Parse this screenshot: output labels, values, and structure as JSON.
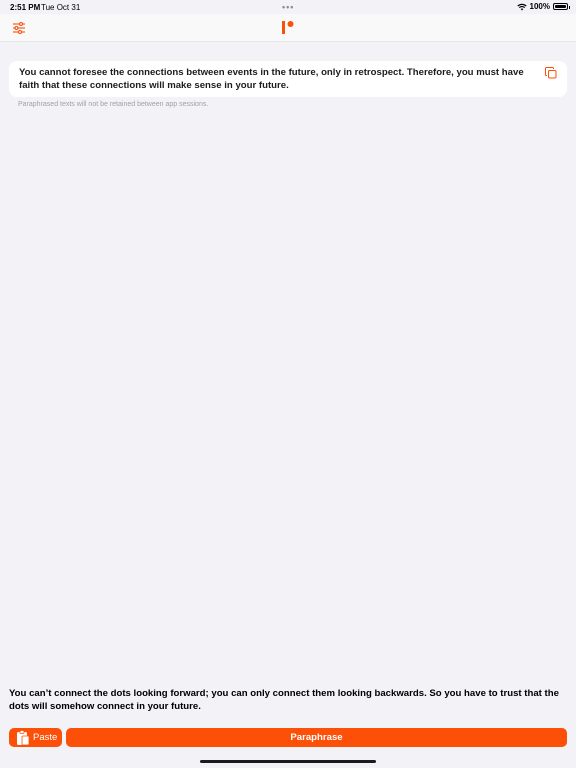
{
  "status_bar": {
    "time": "2:51 PM",
    "date": "Tue Oct 31",
    "multitask_dots": "•••",
    "battery": "100%",
    "battery_level": 1.0
  },
  "colors": {
    "accent": "#fc4f08",
    "background": "#f2f2f7",
    "card": "#ffffff"
  },
  "nav": {
    "settings_icon": "sliders-icon",
    "logo_icon": "app-logo-icon"
  },
  "input": {
    "text": "You cannot foresee the connections between events in the future, only in retrospect. Therefore, you must have faith that these connections will make sense in your future.",
    "copy_icon": "copy-icon"
  },
  "note": "Paraphrased texts will not be retained between app sessions.",
  "source": {
    "text": "You can’t connect the dots looking forward; you can only connect them looking backwards. So you have to trust that the dots will somehow connect in your future."
  },
  "actions": {
    "paste_label": "Paste",
    "paste_icon": "clipboard-icon",
    "paraphrase_label": "Paraphrase"
  }
}
